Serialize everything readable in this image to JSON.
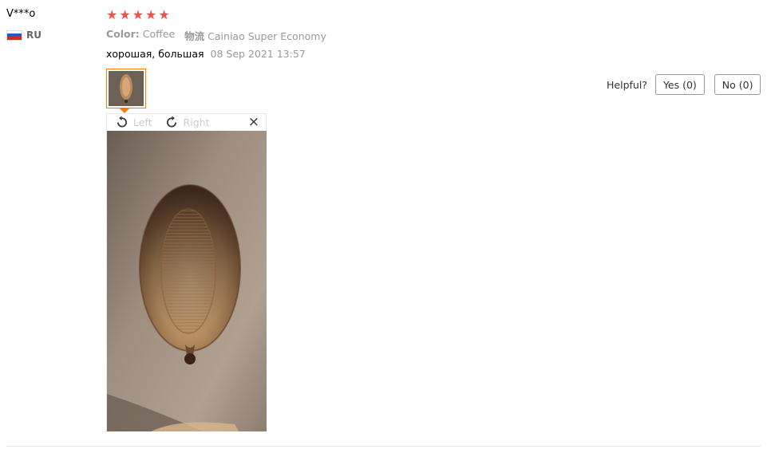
{
  "review": {
    "user_name": "V***o",
    "country": "RU",
    "rating_stars": 5,
    "star_char": "★",
    "color_label": "Color:",
    "color_value": "Coffee",
    "shipping_label": "物流",
    "shipping_value": "Cainiao Super Economy",
    "feedback_text": "хорошая, большая",
    "feedback_date": "08 Sep 2021 13:57",
    "accent_color": "#ff7a00",
    "star_color": "#f0524b"
  },
  "viewer": {
    "rotate_left_label": "Left",
    "rotate_right_label": "Right",
    "close_icon": "×"
  },
  "helpful": {
    "label": "Helpful?",
    "yes_label": "Yes (0)",
    "no_label": "No (0)"
  }
}
